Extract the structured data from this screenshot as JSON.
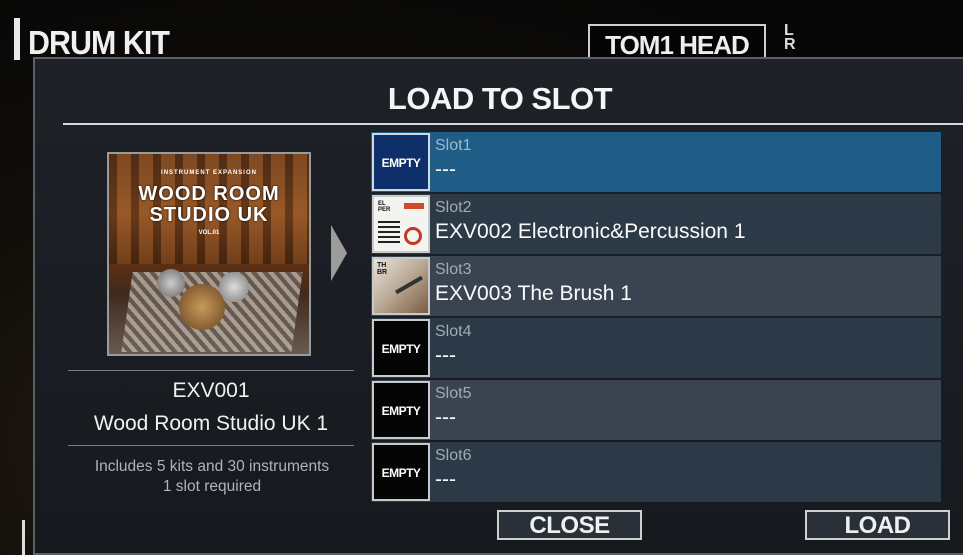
{
  "background": {
    "title": "DRUM KIT",
    "tab": "TOM1 HEAD",
    "side_label": "L\nR"
  },
  "dialog": {
    "title": "LOAD TO SLOT",
    "pack": {
      "cover": {
        "top_text": "INSTRUMENT EXPANSION",
        "main_text_line1": "WOOD ROOM",
        "main_text_line2": "STUDIO UK",
        "volume_text": "VOL.01"
      },
      "id": "EXV001",
      "name": "Wood Room Studio UK 1",
      "description_line1": "Includes 5 kits and 30 instruments",
      "description_line2": "1 slot required"
    },
    "slots": [
      {
        "name": "Slot1",
        "content": "---",
        "thumbnail": "EMPTY",
        "selected": true
      },
      {
        "name": "Slot2",
        "content": "EXV002  Electronic&Percussion 1",
        "thumbnail": "electronic-percussion-cover",
        "selected": false
      },
      {
        "name": "Slot3",
        "content": "EXV003  The Brush 1",
        "thumbnail": "the-brush-cover",
        "selected": false
      },
      {
        "name": "Slot4",
        "content": "---",
        "thumbnail": "EMPTY",
        "selected": false
      },
      {
        "name": "Slot5",
        "content": "---",
        "thumbnail": "EMPTY",
        "selected": false
      },
      {
        "name": "Slot6",
        "content": "---",
        "thumbnail": "EMPTY",
        "selected": false
      }
    ],
    "buttons": {
      "close": "CLOSE",
      "load": "LOAD"
    }
  },
  "colors": {
    "selected_slot": "#1f5c86",
    "slot_background": "#2c3a48",
    "dialog_background": "#1e2228"
  }
}
